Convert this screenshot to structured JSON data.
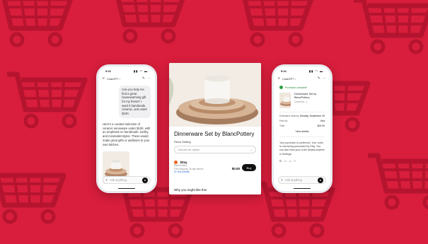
{
  "colors": {
    "background": "#d81e3c",
    "buy_button": "#111111",
    "etsy_orange": "#f1641e",
    "confirm_green": "#2ea043"
  },
  "left_phone": {
    "status": {
      "time": "9:41",
      "icons": "▮▮ ◠ ▬"
    },
    "header": {
      "title": "ChatGPT ›"
    },
    "user_message": "Can you help me find a great housewarming gift for my friend? I want it handmade, ceramic, and under $100.",
    "assistant_message": "Here's a curated selection of ceramic serveware under $100, with an emphasis on handmade, earthy, and minimalist styles. These would make great gifts or additions to your own kitchen.",
    "composer": {
      "placeholder": "Ask anything"
    }
  },
  "product_card": {
    "title": "Dinnerware Set by BlancPottery",
    "option_label": "Piece Setting",
    "dropdown_placeholder": "Choose an option",
    "seller": {
      "name": "Etsy",
      "meta_1": "BlancPottery",
      "meta_2": "Free shipping, 30-day returns",
      "link": "Or Visit website"
    },
    "price": "$0.00",
    "buy_label": "Buy",
    "subheading": "Why you might like this"
  },
  "right_phone": {
    "status": {
      "time": "9:41",
      "icons": "▮▮ ◠ ▬"
    },
    "header": {
      "title": "ChatGPT ›"
    },
    "confirm": "Purchase complete",
    "order": {
      "title": "Dinnerware Set by BlancPottery",
      "sub": "Quantity: 1"
    },
    "rows": [
      {
        "k": "Estimated delivery",
        "v": "Monday, September 29"
      },
      {
        "k": "Paid by",
        "v": "Visa"
      },
      {
        "k": "Total",
        "v": "$00.00"
      }
    ],
    "view_details": "View details",
    "reply": "Your purchase is confirmed. Your order is now being processed by Etsy. You can also view your order details anytime in Settings.",
    "composer": {
      "placeholder": "Ask anything"
    }
  }
}
